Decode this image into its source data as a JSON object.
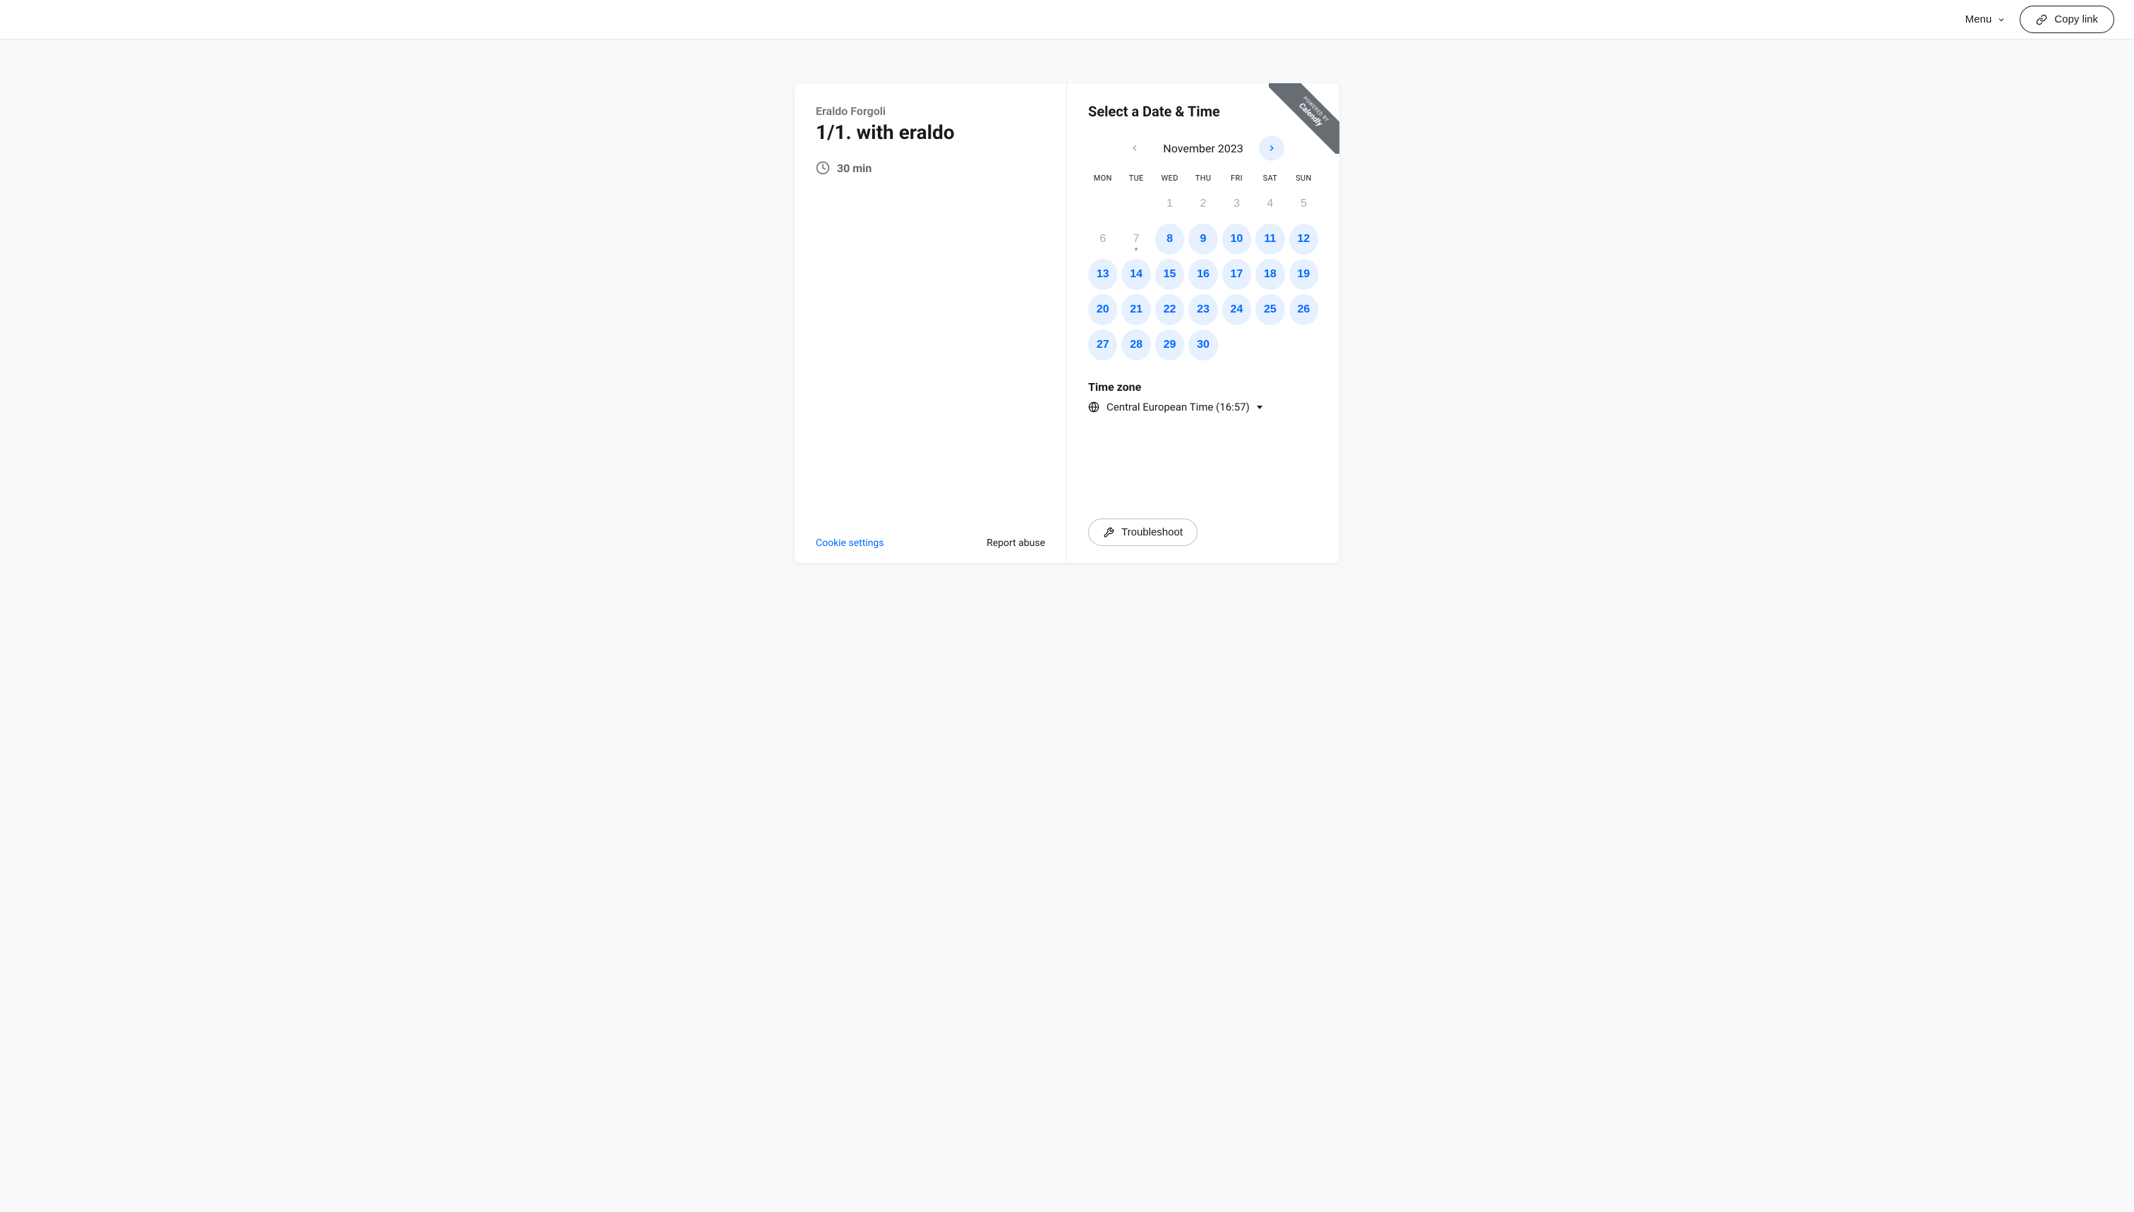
{
  "top_bar": {
    "menu_label": "Menu",
    "copy_link_label": "Copy link"
  },
  "left": {
    "host_name": "Eraldo Forgoli",
    "event_title": "1/1. with eraldo",
    "duration": "30 min",
    "cookie_settings": "Cookie settings",
    "report_abuse": "Report abuse"
  },
  "right": {
    "heading": "Select a Date & Time",
    "month_label": "November 2023",
    "weekdays": [
      "MON",
      "TUE",
      "WED",
      "THU",
      "FRI",
      "SAT",
      "SUN"
    ],
    "leading_blanks": 2,
    "days": [
      {
        "n": 1,
        "available": false,
        "today": false
      },
      {
        "n": 2,
        "available": false,
        "today": false
      },
      {
        "n": 3,
        "available": false,
        "today": false
      },
      {
        "n": 4,
        "available": false,
        "today": false
      },
      {
        "n": 5,
        "available": false,
        "today": false
      },
      {
        "n": 6,
        "available": false,
        "today": false
      },
      {
        "n": 7,
        "available": false,
        "today": true
      },
      {
        "n": 8,
        "available": true,
        "today": false
      },
      {
        "n": 9,
        "available": true,
        "today": false
      },
      {
        "n": 10,
        "available": true,
        "today": false
      },
      {
        "n": 11,
        "available": true,
        "today": false
      },
      {
        "n": 12,
        "available": true,
        "today": false
      },
      {
        "n": 13,
        "available": true,
        "today": false
      },
      {
        "n": 14,
        "available": true,
        "today": false
      },
      {
        "n": 15,
        "available": true,
        "today": false
      },
      {
        "n": 16,
        "available": true,
        "today": false
      },
      {
        "n": 17,
        "available": true,
        "today": false
      },
      {
        "n": 18,
        "available": true,
        "today": false
      },
      {
        "n": 19,
        "available": true,
        "today": false
      },
      {
        "n": 20,
        "available": true,
        "today": false
      },
      {
        "n": 21,
        "available": true,
        "today": false
      },
      {
        "n": 22,
        "available": true,
        "today": false
      },
      {
        "n": 23,
        "available": true,
        "today": false
      },
      {
        "n": 24,
        "available": true,
        "today": false
      },
      {
        "n": 25,
        "available": true,
        "today": false
      },
      {
        "n": 26,
        "available": true,
        "today": false
      },
      {
        "n": 27,
        "available": true,
        "today": false
      },
      {
        "n": 28,
        "available": true,
        "today": false
      },
      {
        "n": 29,
        "available": true,
        "today": false
      },
      {
        "n": 30,
        "available": true,
        "today": false
      }
    ],
    "timezone_label": "Time zone",
    "timezone_value": "Central European Time (16:57)",
    "troubleshoot_label": "Troubleshoot"
  },
  "ribbon": {
    "powered_by": "POWERED BY",
    "brand": "Calendly"
  }
}
